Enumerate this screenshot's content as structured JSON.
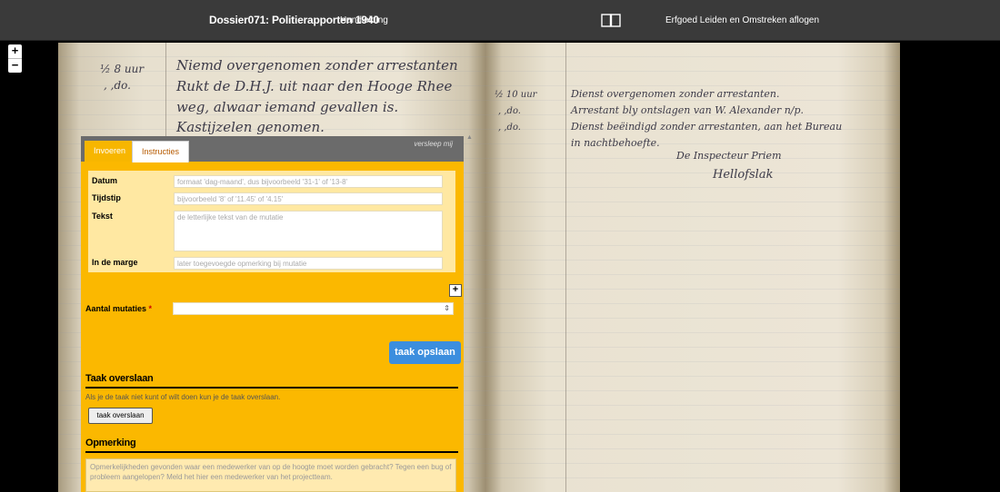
{
  "header": {
    "title": "Dossier071: Politierapporten 1940",
    "guide_link": "Handleiding",
    "login_link": "Erfgoed Leiden en Omstreken aflogen"
  },
  "zoom": {
    "in": "+",
    "out": "−"
  },
  "panel": {
    "tabs": {
      "input": "Invoeren",
      "instructions": "Instructies"
    },
    "drag_hint": "versleep mij",
    "fields": {
      "date_label": "Datum",
      "date_placeholder": "formaat 'dag-maand', dus bijvoorbeeld '31-1' of '13-8'",
      "time_label": "Tijdstip",
      "time_placeholder": "bijvoorbeeld '8' of '11.45' of '4.15'",
      "text_label": "Tekst",
      "text_placeholder": "de letterlijke tekst van de mutatie",
      "margin_label": "In de marge",
      "margin_placeholder": "later toegevoegde opmerking bij mutatie"
    },
    "add_button": "+",
    "count_label": "Aantal mutaties",
    "required_mark": "*",
    "save_button": "taak opslaan",
    "skip": {
      "heading": "Taak overslaan",
      "text": "Als je de taak niet kunt of wilt doen kun je de taak overslaan.",
      "button": "taak overslaan"
    },
    "note": {
      "heading": "Opmerking",
      "placeholder": "Opmerkelijkheden gevonden waar een medewerker van op de hoogte moet worden gebracht? Tegen een bug of probleem aangelopen? Meld het hier een medewerker van het projectteam."
    }
  },
  "scan": {
    "left_margin_1": "½ 8 uur",
    "left_margin_2": ", ,do.",
    "left_line_1": "Niemd overgenomen zonder arrestanten",
    "left_line_2": "Rukt de D.H.J. uit naar den Hooge Rhee",
    "left_line_3": "weg, alwaar iemand gevallen is.",
    "left_line_4": "Kastijzelen genomen.",
    "right_margin_1": "½ 10 uur",
    "right_margin_2": ", ,do.",
    "right_margin_3": ", ,do.",
    "right_line_1": "Dienst overgenomen zonder arrestanten.",
    "right_line_2": "Arrestant bly ontslagen van W. Alexander n/p.",
    "right_line_3": "Dienst beëindigd zonder arrestanten, aan het Bureau",
    "right_line_4": "in nachtbehoefte.",
    "right_sign_1": "De Inspecteur   Priem",
    "right_sign_2": "Hellofslak"
  }
}
